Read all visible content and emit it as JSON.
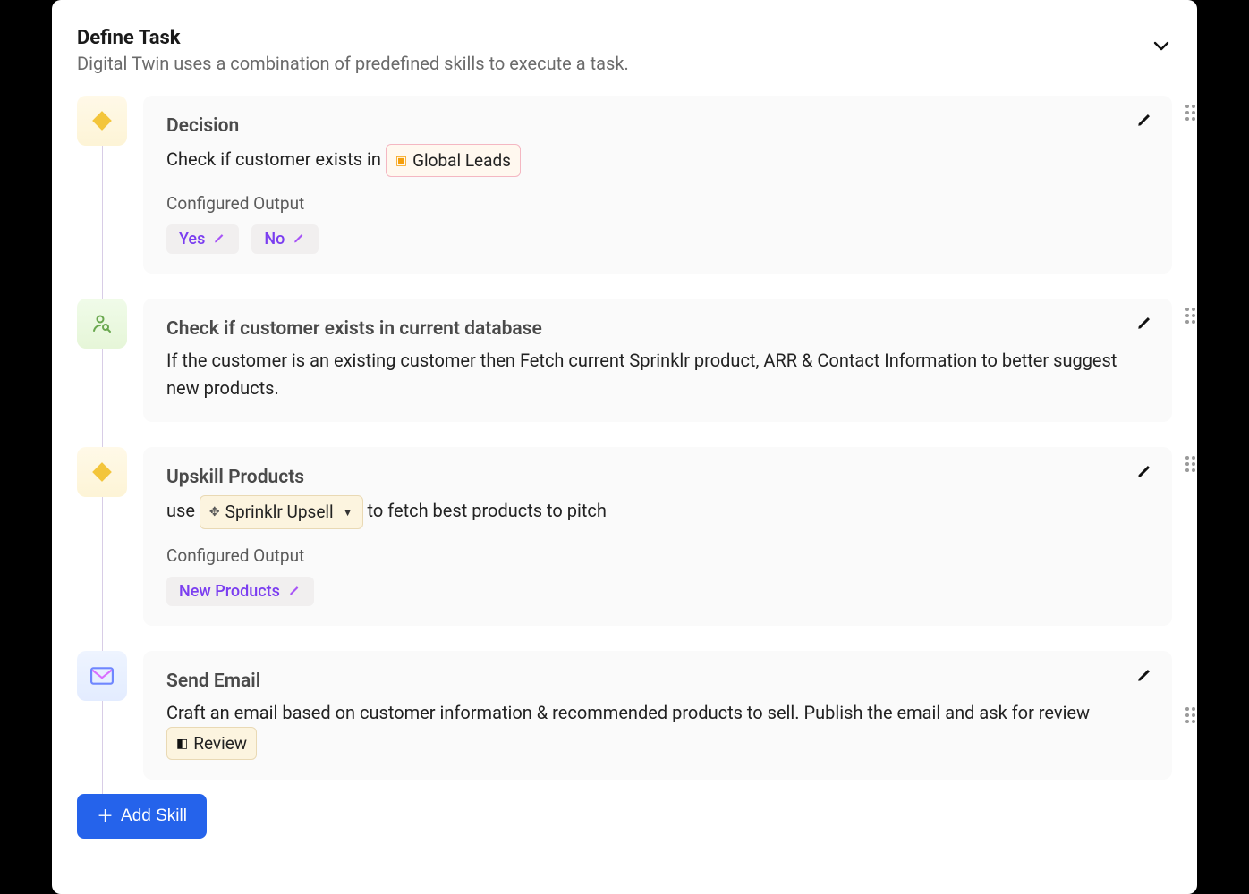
{
  "header": {
    "title": "Define Task",
    "subtitle": "Digital Twin uses a combination of predefined skills to execute a task."
  },
  "steps": [
    {
      "icon": "diamond",
      "title": "Decision",
      "desc_prefix": "Check if customer exists in ",
      "pill_label": "Global Leads",
      "configured_label": "Configured Output",
      "outputs": [
        "Yes",
        "No"
      ]
    },
    {
      "icon": "user-search",
      "title": "Check if customer exists in current database",
      "desc": "If the customer is an existing customer then Fetch current Sprinklr product, ARR & Contact Information to better suggest new products."
    },
    {
      "icon": "diamond",
      "title": "Upskill Products",
      "desc_prefix": "use ",
      "pill_label": "Sprinklr Upsell",
      "desc_suffix": " to fetch best products to pitch",
      "configured_label": "Configured Output",
      "outputs": [
        "New Products"
      ]
    },
    {
      "icon": "email",
      "title": "Send Email",
      "desc_prefix": "Craft an email based on customer information & recommended products to sell. Publish the email and ask for review ",
      "pill_label": "Review"
    }
  ],
  "add_skill_label": "Add Skill"
}
